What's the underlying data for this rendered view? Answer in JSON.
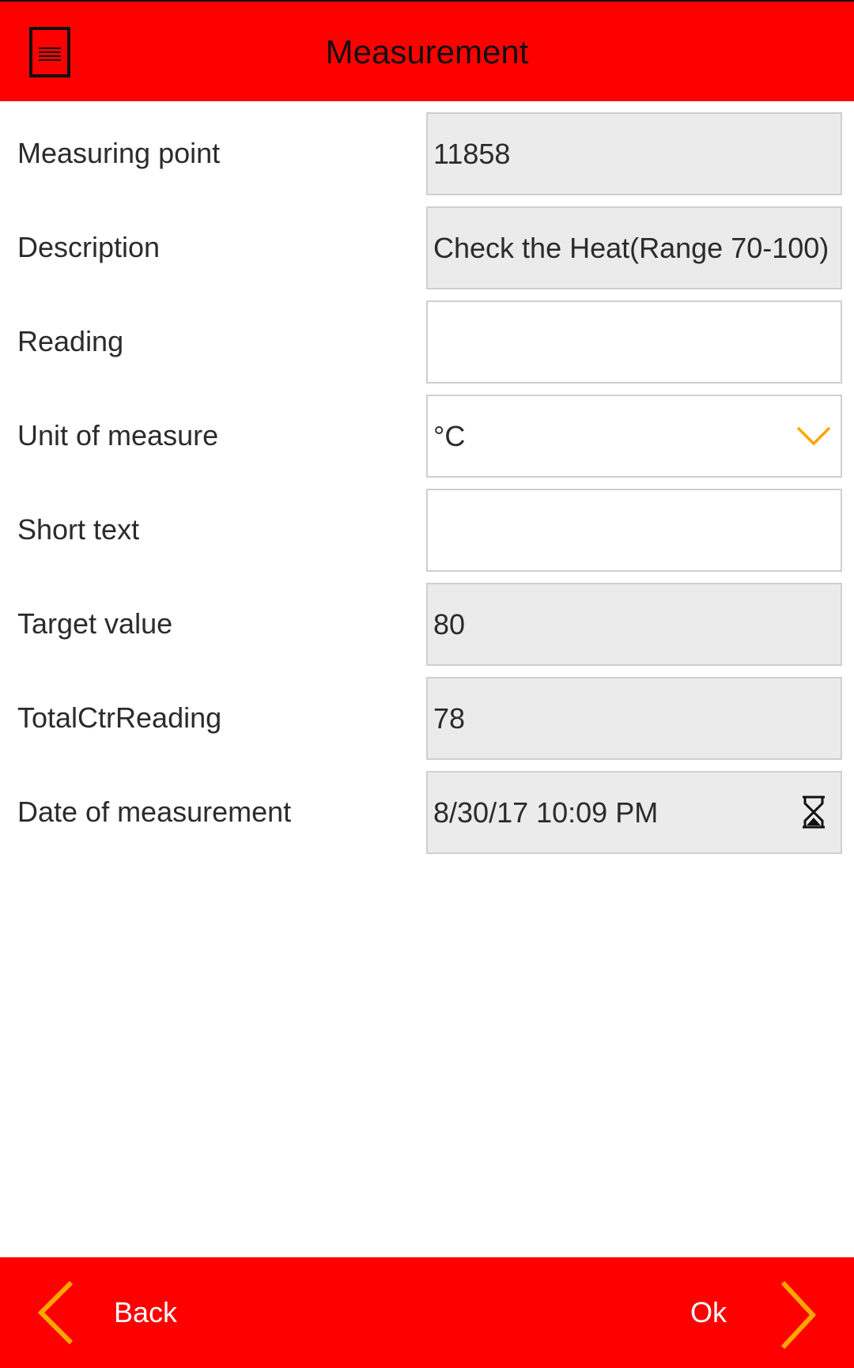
{
  "header": {
    "title": "Measurement",
    "menu_icon": "document-menu-icon",
    "background_color": "#ff0000"
  },
  "form": {
    "rows": [
      {
        "label": "Measuring point",
        "value": "11858",
        "readonly": true
      },
      {
        "label": "Description",
        "value": "Check the Heat(Range 70-100)",
        "readonly": true
      },
      {
        "label": "Reading",
        "value": "",
        "readonly": false
      },
      {
        "label": "Unit of measure",
        "value": "°C",
        "readonly": false,
        "icon": "chevron-down-icon"
      },
      {
        "label": "Short text",
        "value": "",
        "readonly": false
      },
      {
        "label": "Target value",
        "value": "80",
        "readonly": true
      },
      {
        "label": "TotalCtrReading",
        "value": "78",
        "readonly": true
      },
      {
        "label": "Date of measurement",
        "value": "8/30/17 10:09 PM",
        "readonly": true,
        "icon": "hourglass-icon"
      }
    ]
  },
  "footer": {
    "back_label": "Back",
    "ok_label": "Ok",
    "arrow_color": "#ffa500",
    "background_color": "#ff0000"
  }
}
